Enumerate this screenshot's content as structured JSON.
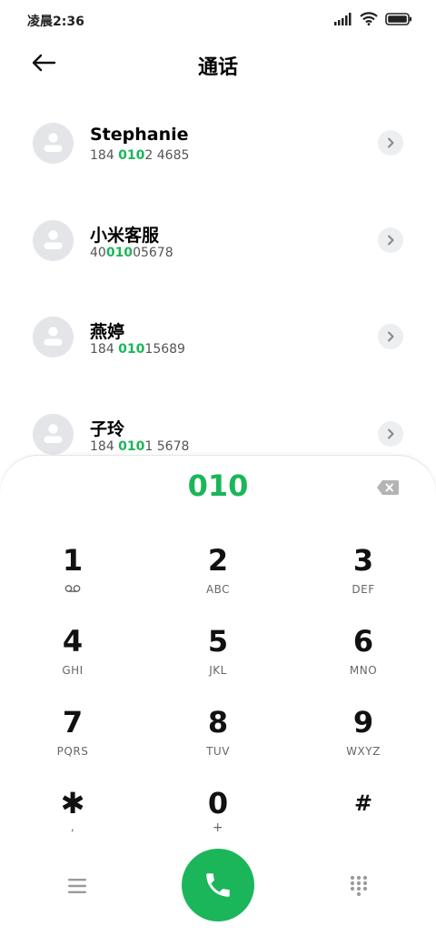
{
  "status": {
    "time": "凌晨2:36"
  },
  "header": {
    "title": "通话"
  },
  "contacts": [
    {
      "name": "Stephanie",
      "num_pre": "184 ",
      "num_hl": "010",
      "num_post": "2 4685"
    },
    {
      "name": "小米客服",
      "num_pre": "40",
      "num_hl": "010",
      "num_post": "05678"
    },
    {
      "name": "燕婷",
      "num_pre": "184 ",
      "num_hl": "010",
      "num_post": "15689"
    },
    {
      "name": "子玲",
      "num_pre": "184 ",
      "num_hl": "010",
      "num_post": "1 5678"
    }
  ],
  "dialpad": {
    "input": "010",
    "keys": [
      {
        "digit": "1",
        "letters": ""
      },
      {
        "digit": "2",
        "letters": "ABC"
      },
      {
        "digit": "3",
        "letters": "DEF"
      },
      {
        "digit": "4",
        "letters": "GHI"
      },
      {
        "digit": "5",
        "letters": "JKL"
      },
      {
        "digit": "6",
        "letters": "MNO"
      },
      {
        "digit": "7",
        "letters": "PQRS"
      },
      {
        "digit": "8",
        "letters": "TUV"
      },
      {
        "digit": "9",
        "letters": "WXYZ"
      },
      {
        "digit": "✱",
        "letters": ","
      },
      {
        "digit": "0",
        "letters": "+"
      },
      {
        "digit": "#",
        "letters": ""
      }
    ]
  },
  "colors": {
    "accent": "#1bb65a",
    "avatar_bg": "#e3e5e8"
  },
  "icons": {
    "back": "arrow-left-icon",
    "chevron": "chevron-right-icon",
    "delete": "backspace-icon",
    "voicemail": "voicemail-icon",
    "menu": "menu-icon",
    "call": "phone-icon",
    "keypad": "dialpad-icon"
  }
}
